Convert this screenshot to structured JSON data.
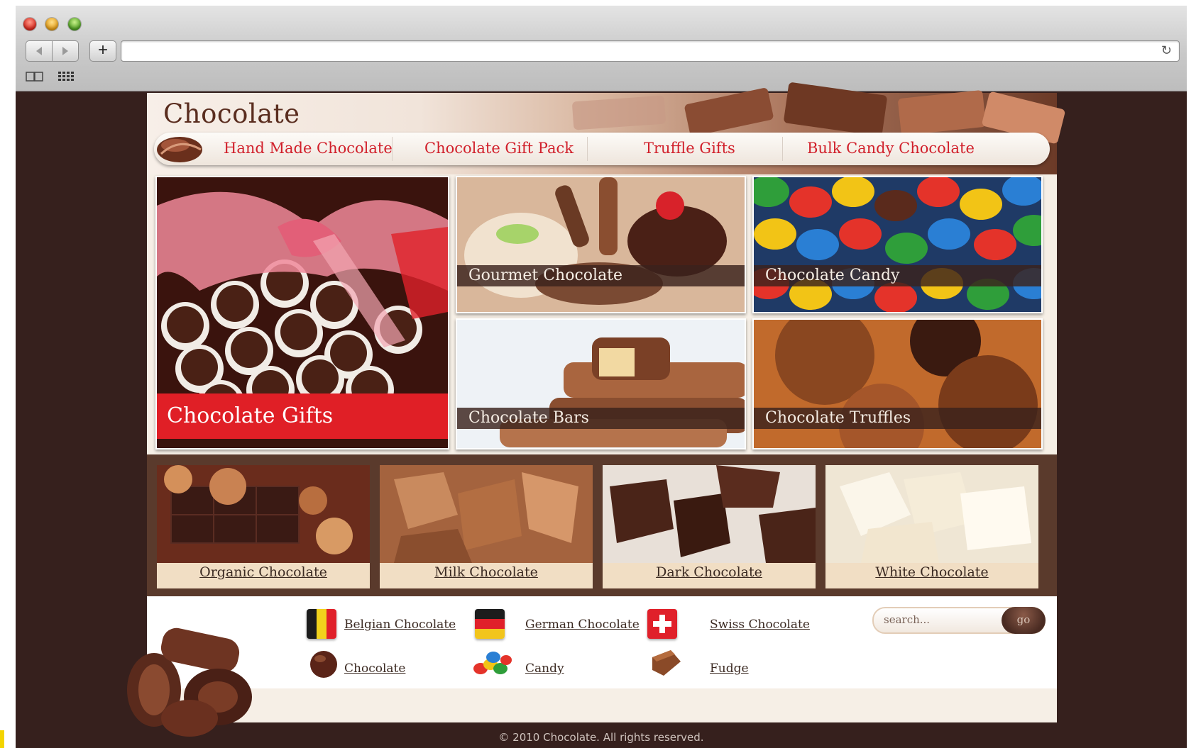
{
  "browser": {
    "traffic_lights": [
      "close",
      "minimize",
      "zoom"
    ],
    "new_tab_label": "+",
    "url": "",
    "reload_icon": "reload-icon"
  },
  "site": {
    "logo": "Chocolate",
    "nav": [
      "Hand Made Chocolate",
      "Chocolate Gift Pack",
      "Truffle Gifts",
      "Bulk Candy Chocolate"
    ],
    "featured": {
      "gifts": "Chocolate Gifts",
      "gourmet": "Gourmet Chocolate",
      "candy": "Chocolate Candy",
      "bars": "Chocolate Bars",
      "truffles": "Chocolate Truffles"
    },
    "categories": [
      "Organic Chocolate",
      "Milk Chocolate",
      "Dark Chocolate",
      "White Chocolate"
    ],
    "links": {
      "belgian": "Belgian Chocolate",
      "german": "German Chocolate",
      "swiss": "Swiss Chocolate",
      "chocolate": "Chocolate",
      "candy": "Candy",
      "fudge": "Fudge"
    },
    "search": {
      "placeholder": "search...",
      "button": "go"
    },
    "footer": "© 2010 Chocolate. All rights reserved."
  },
  "colors": {
    "page_bg": "#36201d",
    "accent_red": "#d1202b",
    "gift_banner": "#e01f26",
    "category_strip": "#5a3a2c"
  }
}
